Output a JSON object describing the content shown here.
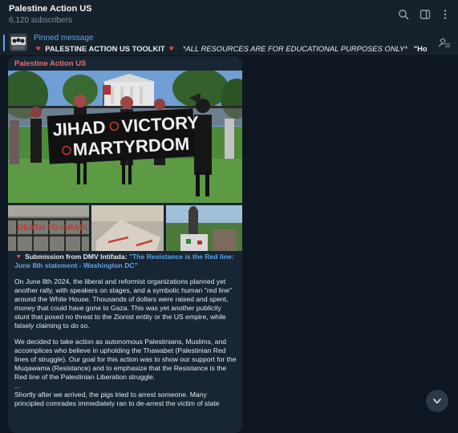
{
  "header": {
    "title": "Palestine Action US",
    "subscribers": "6,120 subscribers",
    "icons": [
      "search-icon",
      "sidebar-toggle-icon",
      "more-vertical-icon"
    ]
  },
  "pinned": {
    "label": "Pinned message",
    "emoji": "🔻",
    "title": "PALESTINE ACTION US TOOLKIT",
    "notice": "*ALL RESOURCES ARE FOR EDUCATIONAL PURPOSES ONLY*",
    "preview": "\"How do I join Pales..."
  },
  "message": {
    "sender": "Palestine Action US",
    "banner_lines": [
      "JIHAD",
      "VICTORY",
      "MARTYRDOM"
    ],
    "thumb1_text": "DEATH TO ISRAEL",
    "submission_prefix": "🔻 Submission from DMV Intifada:",
    "submission_link": "\"The Resistance is the Red line: June 8th statement - Washington DC\"",
    "paragraph1": "On June 8th 2024, the liberal and reformist organizations planned yet another rally, with speakers on stages, and a symbolic human \"red line\" around the White House. Thousands of dollars were raised and spent, money that could have gone to Gaza. This was yet another publicity stunt that posed no threat to the Zionist entity or the US empire, while falsely claiming to do so.",
    "paragraph2": "We decided to take action as autonomous Palestinians, Muslims, and accomplices who believe in upholding the Thawabet (Palestinian Red lines of struggle). Our goal for this action was to show our support for the Muqawama (Resistance) and to emphasize that the Resistance is the Red line of the Palestinian Liberation struggle.",
    "ellipsis": "...",
    "paragraph3": "Shortly after we arrived, the pigs tried to arrest someone. Many principled comrades immediately ran to de-arrest the victim of state"
  },
  "colors": {
    "background": "#0e1621",
    "panel": "#17212b",
    "bubble": "#182533",
    "accent": "#5ea5ea",
    "sender": "#e17076"
  }
}
